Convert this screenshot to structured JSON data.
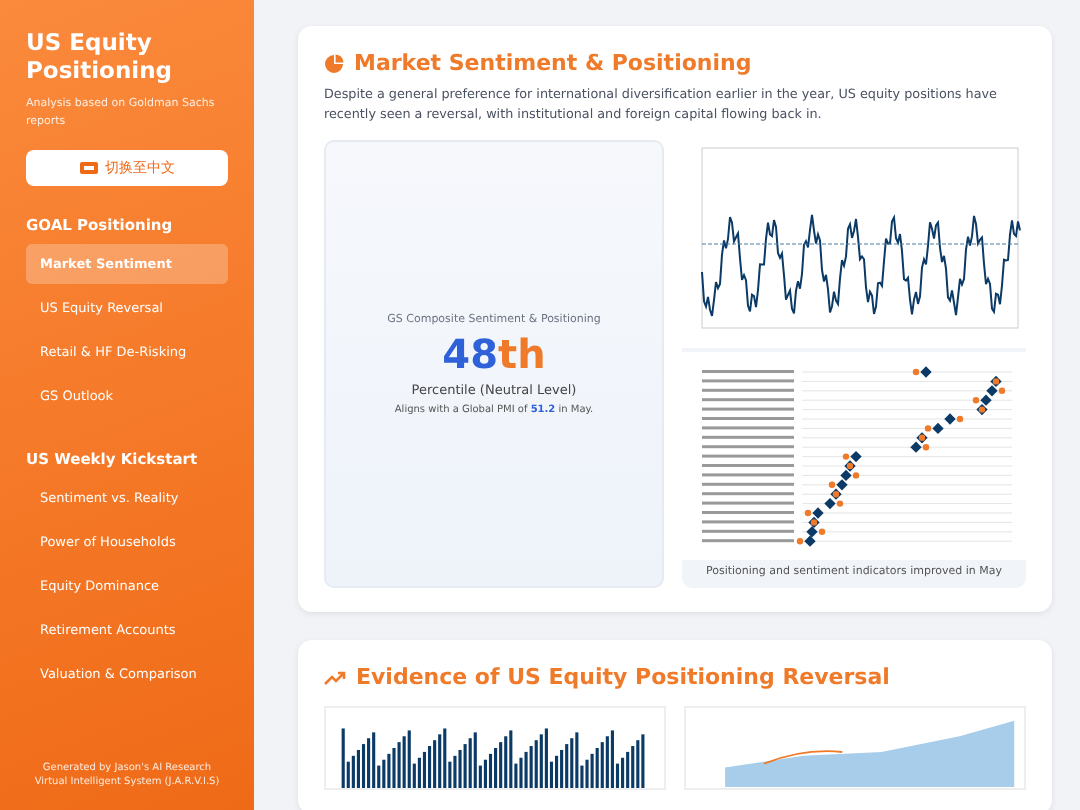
{
  "sidebar": {
    "title": "US Equity Positioning",
    "subtitle": "Analysis based on Goldman Sachs reports",
    "language_button": {
      "label": "切换至中文"
    },
    "sections": [
      {
        "heading": "GOAL Positioning",
        "items": [
          {
            "label": "Market Sentiment",
            "selected": true
          },
          {
            "label": "US Equity Reversal",
            "selected": false
          },
          {
            "label": "Retail & HF De-Risking",
            "selected": false
          },
          {
            "label": "GS Outlook",
            "selected": false
          }
        ]
      },
      {
        "heading": "US Weekly Kickstart",
        "items": [
          {
            "label": "Sentiment vs. Reality",
            "selected": false
          },
          {
            "label": "Power of Households",
            "selected": false
          },
          {
            "label": "Equity Dominance",
            "selected": false
          },
          {
            "label": "Retirement Accounts",
            "selected": false
          },
          {
            "label": "Valuation & Comparison",
            "selected": false
          }
        ]
      }
    ],
    "footer": "Generated by Jason's AI Research Virtual Intelligent System (J.A.R.V.I.S)"
  },
  "sections": [
    {
      "title": "Market Sentiment & Positioning",
      "description": "Despite a general preference for international diversification earlier in the year, US equity positions have recently seen a reversal, with institutional and foreign capital flowing back in.",
      "stat": {
        "label": "GS Composite Sentiment & Positioning",
        "value_number": "48",
        "value_suffix": "th",
        "caption": "Percentile (Neutral Level)",
        "note": "Aligns with a Global PMI of **51.2** in May."
      },
      "figure": {
        "caption": "Positioning and sentiment indicators improved in May"
      }
    },
    {
      "title": "Evidence of US Equity Positioning Reversal"
    }
  ]
}
